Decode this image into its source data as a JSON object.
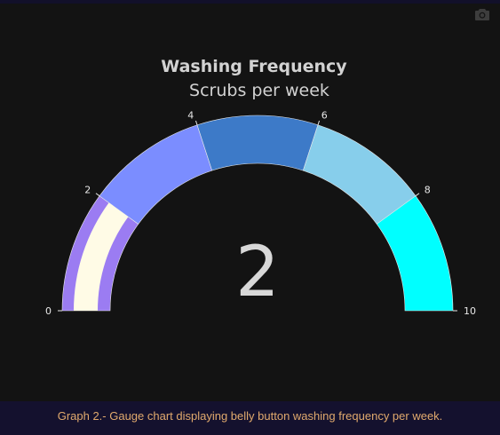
{
  "chart_data": {
    "type": "gauge",
    "title": "Washing Frequency",
    "subtitle": "Scrubs per week",
    "value": 2,
    "value_label": "2",
    "range": [
      0,
      10
    ],
    "ticks": [
      0,
      2,
      4,
      6,
      8,
      10
    ],
    "tick_labels": [
      "0",
      "2",
      "4",
      "6",
      "8",
      "10"
    ],
    "steps": [
      {
        "range": [
          0,
          2
        ],
        "color": "#9b7cf2"
      },
      {
        "range": [
          2,
          4
        ],
        "color": "#7b8dff"
      },
      {
        "range": [
          4,
          6
        ],
        "color": "#3d7ac8"
      },
      {
        "range": [
          6,
          8
        ],
        "color": "#87ceeb"
      },
      {
        "range": [
          8,
          10
        ],
        "color": "#00ffff"
      }
    ],
    "bar_color": "#fffbe6"
  },
  "caption": "Graph 2.- Gauge chart displaying belly button washing frequency per week.",
  "icons": {
    "camera": "camera-icon"
  }
}
